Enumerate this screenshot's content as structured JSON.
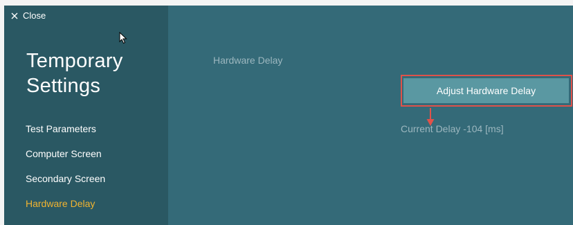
{
  "window": {
    "close_label": "Close",
    "close_icon": "close-icon",
    "cursor_icon": "mouse-pointer-icon"
  },
  "sidebar": {
    "title_line1": "Temporary",
    "title_line2": "Settings",
    "items": [
      {
        "label": "Test Parameters",
        "active": false
      },
      {
        "label": "Computer Screen",
        "active": false
      },
      {
        "label": "Secondary Screen",
        "active": false
      },
      {
        "label": "Hardware Delay",
        "active": true
      }
    ]
  },
  "main": {
    "section_label": "Hardware Delay",
    "adjust_button_label": "Adjust Hardware Delay",
    "current_delay_text": "Current Delay -104 [ms]",
    "annotation_icon": "arrow-down-icon"
  },
  "colors": {
    "sidebar_bg": "#2a5863",
    "main_bg": "#346a78",
    "button_bg": "#5a98a2",
    "active_item": "#f2b430",
    "highlight": "#e0524a"
  }
}
